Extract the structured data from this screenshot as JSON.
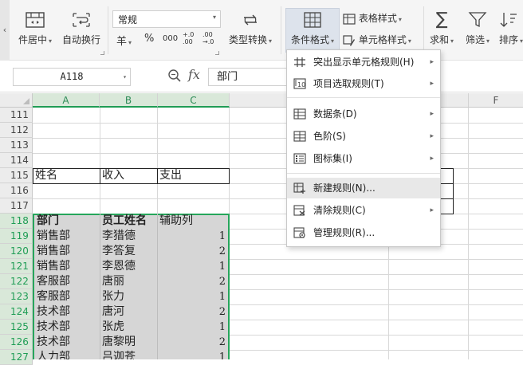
{
  "ribbon": {
    "merge_center_label": "件居中",
    "wrap_label": "自动换行",
    "number_format_value": "常规",
    "currency_symbol": "羊",
    "percent_symbol": "%",
    "thousands_symbol": "000",
    "dec_increase_symbol": "+.0 .00",
    "dec_decrease_symbol": ".00 →.0",
    "type_convert_label": "类型转换",
    "conditional_format_label": "条件格式",
    "table_style_label": "表格样式",
    "cell_style_label": "单元格样式",
    "sum_label": "求和",
    "filter_label": "筛选",
    "sort_label": "排序"
  },
  "formula_bar": {
    "name_box_value": "A118",
    "fx_label": "fx",
    "formula_value": "部门"
  },
  "columns": [
    "A",
    "B",
    "C",
    "F"
  ],
  "rows": {
    "r111": "111",
    "r112": "112",
    "r113": "113",
    "r114": "114",
    "r115": "115",
    "r116": "116",
    "r117": "117",
    "r118": "118",
    "r119": "119",
    "r120": "120",
    "r121": "121",
    "r122": "122",
    "r123": "123",
    "r124": "124",
    "r125": "125",
    "r126": "126",
    "r127": "127"
  },
  "cells": {
    "r115": [
      "姓名",
      "收入",
      "支出"
    ],
    "header": [
      "部门",
      "员工姓名",
      "辅助列"
    ],
    "data": [
      [
        "销售部",
        "李猎德",
        "1"
      ],
      [
        "销售部",
        "李答复",
        "2"
      ],
      [
        "销售部",
        "李恩德",
        "1"
      ],
      [
        "客服部",
        "唐丽",
        "2"
      ],
      [
        "客服部",
        "张力",
        "1"
      ],
      [
        "技术部",
        "唐河",
        "2"
      ],
      [
        "技术部",
        "张虎",
        "1"
      ],
      [
        "技术部",
        "唐黎明",
        "2"
      ],
      [
        "人力部",
        "吕迦苍",
        "1"
      ]
    ]
  },
  "menu": {
    "items": [
      {
        "label": "突出显示单元格规则(H)",
        "has_submenu": true
      },
      {
        "label": "项目选取规则(T)",
        "has_submenu": true
      },
      {
        "label": "数据条(D)",
        "has_submenu": true
      },
      {
        "label": "色阶(S)",
        "has_submenu": true
      },
      {
        "label": "图标集(I)",
        "has_submenu": true
      },
      {
        "label": "新建规则(N)...",
        "has_submenu": false
      },
      {
        "label": "清除规则(C)",
        "has_submenu": true
      },
      {
        "label": "管理规则(R)...",
        "has_submenu": false
      }
    ],
    "highlighted_item": "新建规则(N)..."
  },
  "colors": {
    "selection_border": "#26a65b",
    "selection_fill": "#d6d6d6",
    "active_tool": "#dde3ec",
    "highlight_menu": "#e8e8e8"
  }
}
